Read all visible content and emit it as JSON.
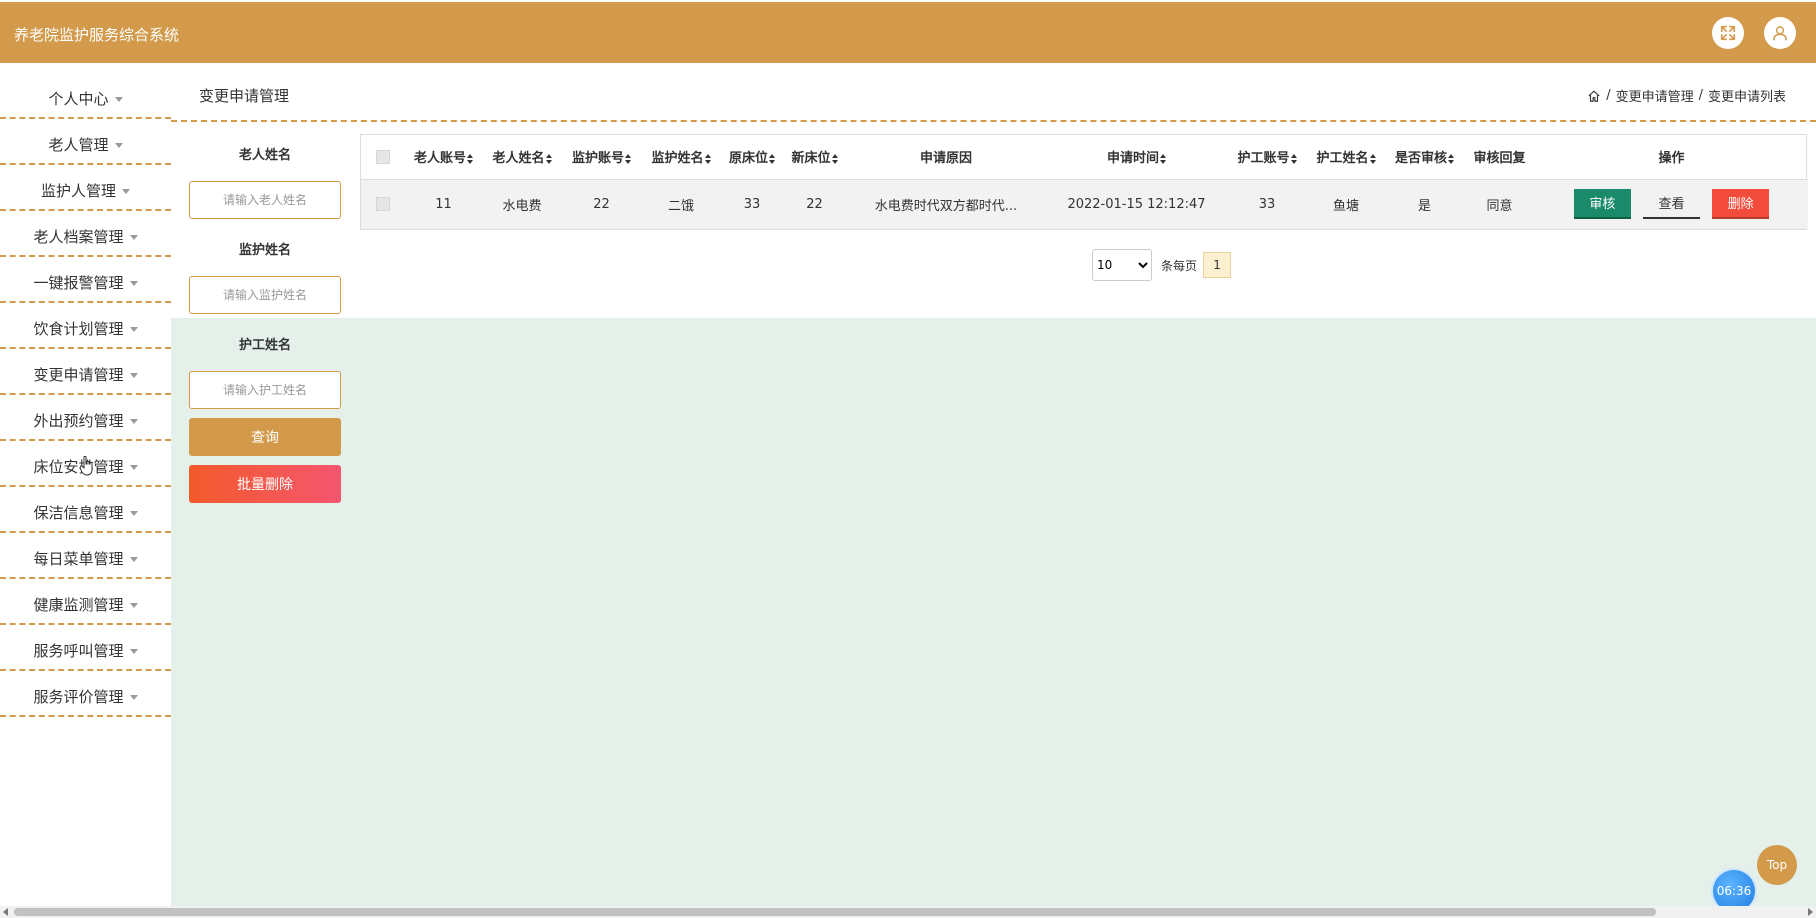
{
  "header": {
    "app_title": "养老院监护服务综合系统",
    "colors": {
      "accent": "#d29a4a",
      "danger": "#f34c3c",
      "success": "#1a8a6a",
      "content_bg": "#e5f0eb"
    }
  },
  "sidebar": {
    "items": [
      {
        "label": "个人中心"
      },
      {
        "label": "老人管理"
      },
      {
        "label": "监护人管理"
      },
      {
        "label": "老人档案管理"
      },
      {
        "label": "一键报警管理"
      },
      {
        "label": "饮食计划管理"
      },
      {
        "label": "变更申请管理"
      },
      {
        "label": "外出预约管理"
      },
      {
        "label": "床位安排管理"
      },
      {
        "label": "保洁信息管理"
      },
      {
        "label": "每日菜单管理"
      },
      {
        "label": "健康监测管理"
      },
      {
        "label": "服务呼叫管理"
      },
      {
        "label": "服务评价管理"
      }
    ]
  },
  "page": {
    "title": "变更申请管理",
    "breadcrumb": {
      "sep1": "/",
      "item1": "变更申请管理",
      "sep2": "/",
      "item2": "变更申请列表"
    }
  },
  "search": {
    "elder_name_label": "老人姓名",
    "elder_name_placeholder": "请输入老人姓名",
    "guardian_name_label": "监护姓名",
    "guardian_name_placeholder": "请输入监护姓名",
    "nurse_name_label": "护工姓名",
    "nurse_name_placeholder": "请输入护工姓名",
    "query_label": "查询",
    "batch_delete_label": "批量删除"
  },
  "table": {
    "headers": [
      "老人账号",
      "老人姓名",
      "监护账号",
      "监护姓名",
      "原床位",
      "新床位",
      "申请原因",
      "申请时间",
      "护工账号",
      "护工姓名",
      "是否审核",
      "审核回复",
      "操作"
    ],
    "rows": [
      {
        "elder_account": "11",
        "elder_name": "水电费",
        "guardian_account": "22",
        "guardian_name": "二饿",
        "old_bed": "33",
        "new_bed": "22",
        "reason": "水电费时代双方都时代...",
        "apply_time": "2022-01-15 12:12:47",
        "nurse_account": "33",
        "nurse_name": "鱼塘",
        "audited": "是",
        "audit_reply": "同意",
        "actions": {
          "audit": "审核",
          "view": "查看",
          "delete": "删除"
        }
      }
    ]
  },
  "pagination": {
    "page_size": "10",
    "page_size_options": [
      "10"
    ],
    "per_page_label": "条每页",
    "current_page": "1"
  },
  "floating": {
    "top_label": "Top",
    "clock": "06:36"
  }
}
